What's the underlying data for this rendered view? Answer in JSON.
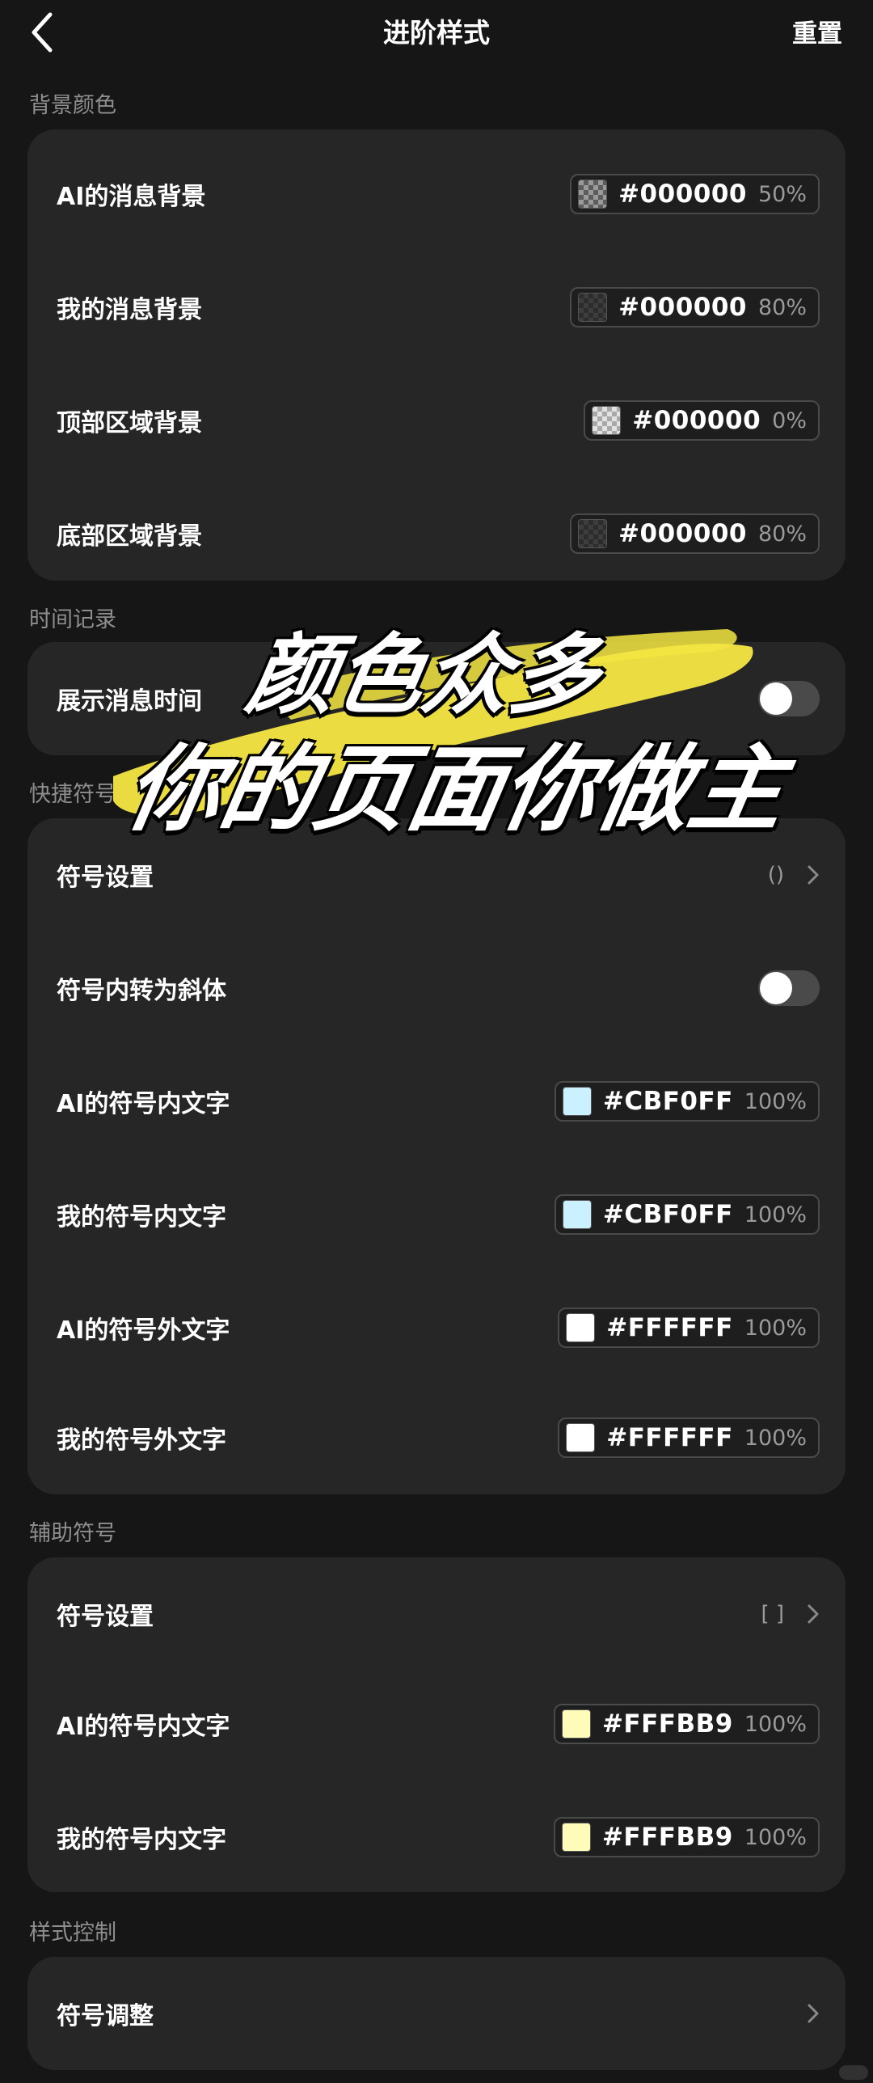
{
  "header": {
    "title": "进阶样式",
    "reset_label": "重置"
  },
  "sections": {
    "background": {
      "title": "背景颜色",
      "rows": [
        {
          "label": "AI的消息背景",
          "hex": "#000000",
          "percent": "50%"
        },
        {
          "label": "我的消息背景",
          "hex": "#000000",
          "percent": "80%"
        },
        {
          "label": "顶部区域背景",
          "hex": "#000000",
          "percent": "0%"
        },
        {
          "label": "底部区域背景",
          "hex": "#000000",
          "percent": "80%"
        }
      ]
    },
    "time": {
      "title": "时间记录",
      "rows": [
        {
          "label": "展示消息时间",
          "toggle_on": false
        }
      ]
    },
    "quick_symbols": {
      "title": "快捷符号",
      "rows": [
        {
          "label": "符号设置",
          "value": "()"
        },
        {
          "label": "符号内转为斜体",
          "toggle_on": false
        },
        {
          "label": "AI的符号内文字",
          "hex": "#CBF0FF",
          "percent": "100%",
          "color": "#CBF0FF"
        },
        {
          "label": "我的符号内文字",
          "hex": "#CBF0FF",
          "percent": "100%",
          "color": "#CBF0FF"
        },
        {
          "label": "AI的符号外文字",
          "hex": "#FFFFFF",
          "percent": "100%",
          "color": "#FFFFFF"
        },
        {
          "label": "我的符号外文字",
          "hex": "#FFFFFF",
          "percent": "100%",
          "color": "#FFFFFF"
        }
      ]
    },
    "aux_symbols": {
      "title": "辅助符号",
      "rows": [
        {
          "label": "符号设置",
          "value": "[ ]"
        },
        {
          "label": "AI的符号内文字",
          "hex": "#FFFBB9",
          "percent": "100%",
          "color": "#FFFBB9"
        },
        {
          "label": "我的符号内文字",
          "hex": "#FFFBB9",
          "percent": "100%",
          "color": "#FFFBB9"
        }
      ]
    },
    "style_control": {
      "title": "样式控制",
      "rows": [
        {
          "label": "符号调整"
        }
      ]
    }
  },
  "overlay": {
    "line1": "颜色众多",
    "line2": "你的页面你做主",
    "highlight_color": "#F5E642"
  },
  "colors": {
    "background": "#161616",
    "card": "#262626",
    "toggle_off": "#4a4a4a"
  }
}
